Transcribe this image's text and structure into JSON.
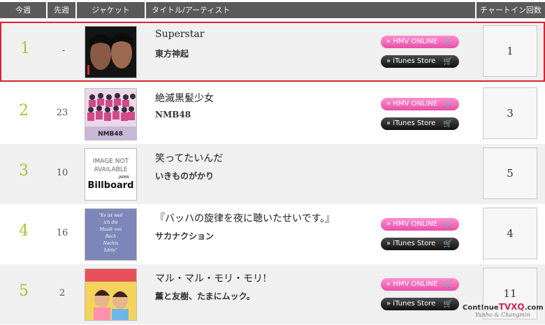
{
  "header": {
    "this_week": "今週",
    "prev_week": "先週",
    "jacket": "ジャケット",
    "title_artist": "タイトル/アーティスト",
    "chart_in_count": "チャートイン回数"
  },
  "buttons": {
    "hmv": "HMV ONLINE",
    "itunes": "iTunes Store"
  },
  "rows": [
    {
      "rank": "1",
      "prev": "-",
      "title": "Superstar",
      "artist": "東方神起",
      "count": "1",
      "buttons": true
    },
    {
      "rank": "2",
      "prev": "23",
      "title": "絶滅黒髪少女",
      "artist": "NMB48",
      "count": "3",
      "buttons": true
    },
    {
      "rank": "3",
      "prev": "10",
      "title": "笑ってたいんだ",
      "artist": "いきものがかり",
      "count": "5",
      "buttons": false,
      "placeholder": {
        "line1": "IMAGE NOT",
        "line2": "AVAILABLE",
        "brand": "Billboard",
        "brand_sub": "JAPAN"
      }
    },
    {
      "rank": "4",
      "prev": "16",
      "title": "『バッハの旋律を夜に聴いたせいです。』",
      "artist": "サカナクション",
      "count": "4",
      "buttons": true,
      "cover_text": [
        "\"Es ist weil",
        "ich die",
        "Musik von",
        "Bach",
        "Nachts",
        "hörte\""
      ]
    },
    {
      "rank": "5",
      "prev": "2",
      "title": "マル・マル・モリ・モリ!",
      "artist": "薫と友樹、たまにムック。",
      "count": "11",
      "buttons": true
    }
  ],
  "watermark": {
    "prefix": "Cont!nue",
    "brand": "TVXQ",
    "suffix": ".com",
    "sub": "Yunho & Changmin"
  },
  "colors": {
    "rank": "#a8c234",
    "highlight": "#d9232d",
    "hmv": "#e84fa9",
    "header": "#5a5a5a"
  }
}
